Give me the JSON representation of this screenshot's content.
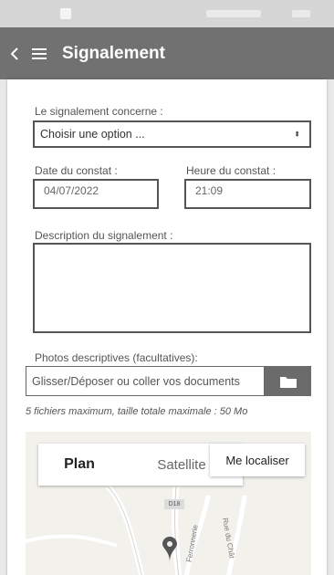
{
  "header": {
    "title": "Signalement",
    "back_icon": "chevron-left-icon",
    "menu_icon": "hamburger-menu-icon"
  },
  "form": {
    "concern_label": "Le signalement concerne :",
    "concern_value": "Choisir une option ...",
    "date_label": "Date du constat :",
    "date_value": "04/07/2022",
    "time_label": "Heure du constat :",
    "time_value": "21:09",
    "description_label": "Description du signalement :",
    "description_value": "",
    "photos_label": "Photos descriptives (facultatives):",
    "photos_placeholder": "Glisser/Déposer ou coller vos documents",
    "photos_button_icon": "folder-icon",
    "photos_hint": "5 fichiers maximum, taille totale maximale : 50 Mo"
  },
  "map": {
    "tabs": [
      "Plan",
      "Satellite"
    ],
    "active_tab": "Plan",
    "locate_label": "Me localiser",
    "road_badge": "D18",
    "road_labels": [
      "Ferronnerie",
      "Rue du Chât"
    ],
    "pin_icon": "map-pin-icon"
  },
  "colors": {
    "appbar": "#717171",
    "background": "#e9e9e9",
    "button": "#6b6b6b"
  }
}
